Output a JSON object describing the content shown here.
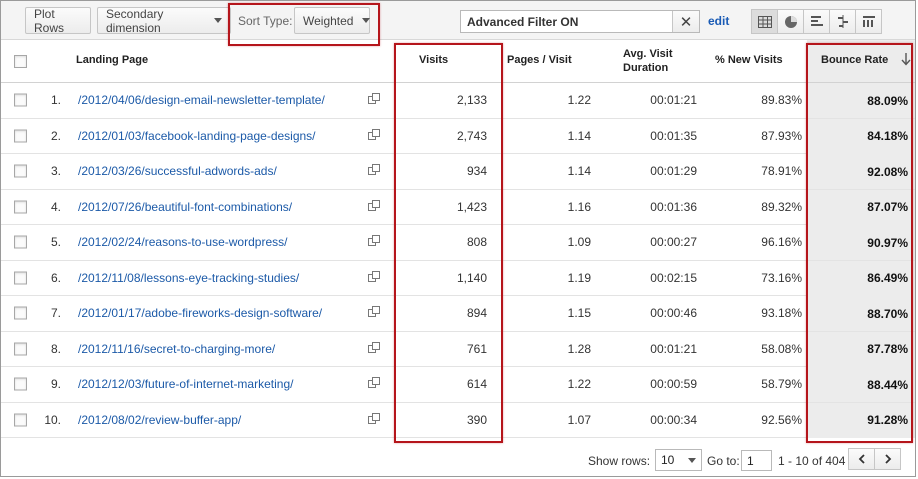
{
  "toolbar": {
    "plot_rows": "Plot Rows",
    "secondary_dimension": "Secondary dimension",
    "sort_type_label": "Sort Type:",
    "sort_type_value": "Weighted",
    "filter_text": "Advanced Filter ON",
    "edit_label": "edit",
    "views": [
      "table-view-icon",
      "pie-view-icon",
      "performance-view-icon",
      "comparison-view-icon",
      "pivot-view-icon"
    ]
  },
  "table": {
    "headers": {
      "landing_page": "Landing Page",
      "visits": "Visits",
      "pages_visit": "Pages / Visit",
      "avg_visit_duration": "Avg. Visit Duration",
      "new_visits": "% New Visits",
      "bounce_rate": "Bounce Rate"
    },
    "rows": [
      {
        "index": "1.",
        "page": "/2012/04/06/design-email-newsletter-template/",
        "visits": "2,133",
        "pages": "1.22",
        "duration": "00:01:21",
        "new": "89.83%",
        "bounce": "88.09%"
      },
      {
        "index": "2.",
        "page": "/2012/01/03/facebook-landing-page-designs/",
        "visits": "2,743",
        "pages": "1.14",
        "duration": "00:01:35",
        "new": "87.93%",
        "bounce": "84.18%"
      },
      {
        "index": "3.",
        "page": "/2012/03/26/successful-adwords-ads/",
        "visits": "934",
        "pages": "1.14",
        "duration": "00:01:29",
        "new": "78.91%",
        "bounce": "92.08%"
      },
      {
        "index": "4.",
        "page": "/2012/07/26/beautiful-font-combinations/",
        "visits": "1,423",
        "pages": "1.16",
        "duration": "00:01:36",
        "new": "89.32%",
        "bounce": "87.07%"
      },
      {
        "index": "5.",
        "page": "/2012/02/24/reasons-to-use-wordpress/",
        "visits": "808",
        "pages": "1.09",
        "duration": "00:00:27",
        "new": "96.16%",
        "bounce": "90.97%"
      },
      {
        "index": "6.",
        "page": "/2012/11/08/lessons-eye-tracking-studies/",
        "visits": "1,140",
        "pages": "1.19",
        "duration": "00:02:15",
        "new": "73.16%",
        "bounce": "86.49%"
      },
      {
        "index": "7.",
        "page": "/2012/01/17/adobe-fireworks-design-software/",
        "visits": "894",
        "pages": "1.15",
        "duration": "00:00:46",
        "new": "93.18%",
        "bounce": "88.70%"
      },
      {
        "index": "8.",
        "page": "/2012/11/16/secret-to-charging-more/",
        "visits": "761",
        "pages": "1.28",
        "duration": "00:01:21",
        "new": "58.08%",
        "bounce": "87.78%"
      },
      {
        "index": "9.",
        "page": "/2012/12/03/future-of-internet-marketing/",
        "visits": "614",
        "pages": "1.22",
        "duration": "00:00:59",
        "new": "58.79%",
        "bounce": "88.44%"
      },
      {
        "index": "10.",
        "page": "/2012/08/02/review-buffer-app/",
        "visits": "390",
        "pages": "1.07",
        "duration": "00:00:34",
        "new": "92.56%",
        "bounce": "91.28%"
      }
    ]
  },
  "pagination": {
    "show_rows_label": "Show rows:",
    "show_rows_value": "10",
    "goto_label": "Go to:",
    "goto_value": "1",
    "range_text": "1 - 10 of 404"
  },
  "colors": {
    "link": "#1c5aa8",
    "highlight": "#b5151b"
  }
}
